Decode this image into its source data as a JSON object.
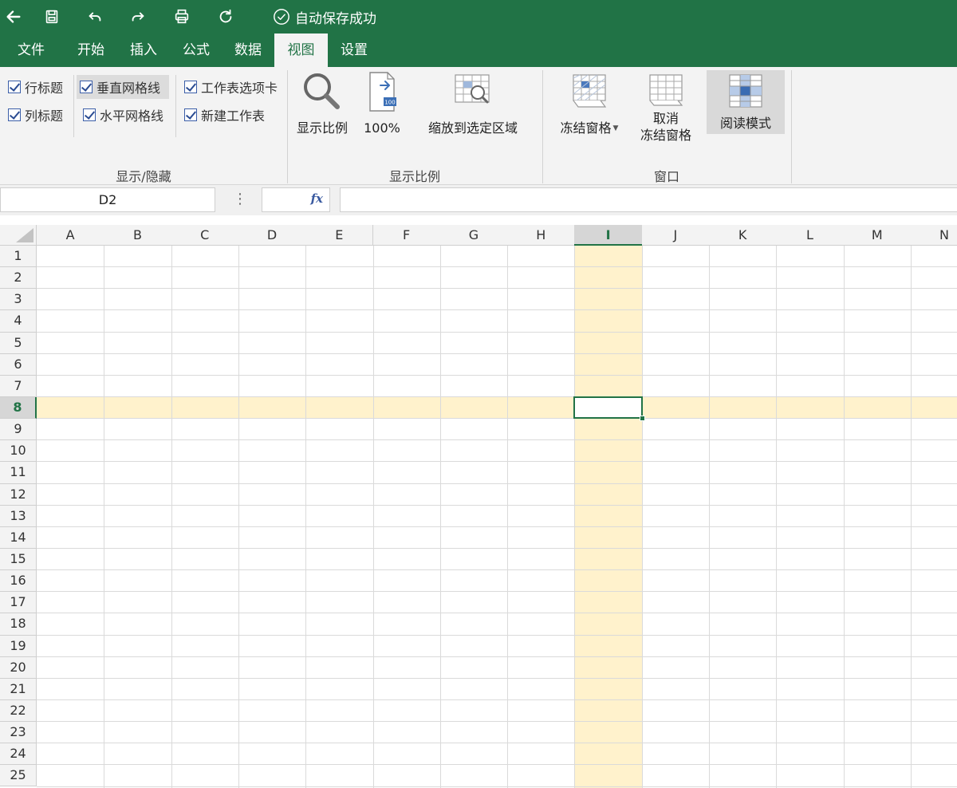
{
  "titlebar": {
    "save_status": "自动保存成功"
  },
  "tabs": [
    {
      "label": "文件"
    },
    {
      "label": "开始"
    },
    {
      "label": "插入"
    },
    {
      "label": "公式"
    },
    {
      "label": "数据"
    },
    {
      "label": "视图"
    },
    {
      "label": "设置"
    }
  ],
  "active_tab": "视图",
  "ribbon": {
    "show_hide": {
      "label": "显示/隐藏",
      "row_headers": "行标题",
      "col_headers": "列标题",
      "vertical_gridlines": "垂直网格线",
      "horizontal_gridlines": "水平网格线",
      "sheet_tabs": "工作表选项卡",
      "new_sheet": "新建工作表"
    },
    "zoom": {
      "label": "显示比例",
      "zoom_button": "显示比例",
      "hundred_button": "100%",
      "icon_text": "100",
      "zoom_to_selection": "缩放到选定区域"
    },
    "window": {
      "label": "窗口",
      "freeze_panes": "冻结窗格",
      "unfreeze_line1": "取消",
      "unfreeze_line2": "冻结窗格",
      "reading_mode": "阅读模式"
    }
  },
  "formula_bar": {
    "name_box": "D2",
    "fx_label": "fx",
    "formula": ""
  },
  "sheet": {
    "columns": [
      "A",
      "B",
      "C",
      "D",
      "E",
      "F",
      "G",
      "H",
      "I",
      "J",
      "K",
      "L",
      "M",
      "N"
    ],
    "rows": [
      "1",
      "2",
      "3",
      "4",
      "5",
      "6",
      "7",
      "8",
      "9",
      "10",
      "11",
      "12",
      "13",
      "14",
      "15",
      "16",
      "17",
      "18",
      "19",
      "20",
      "21",
      "22",
      "23",
      "24",
      "25"
    ],
    "active_column": "I",
    "active_row": "8"
  },
  "colors": {
    "brand": "#217346",
    "highlight": "#fff2cc"
  }
}
